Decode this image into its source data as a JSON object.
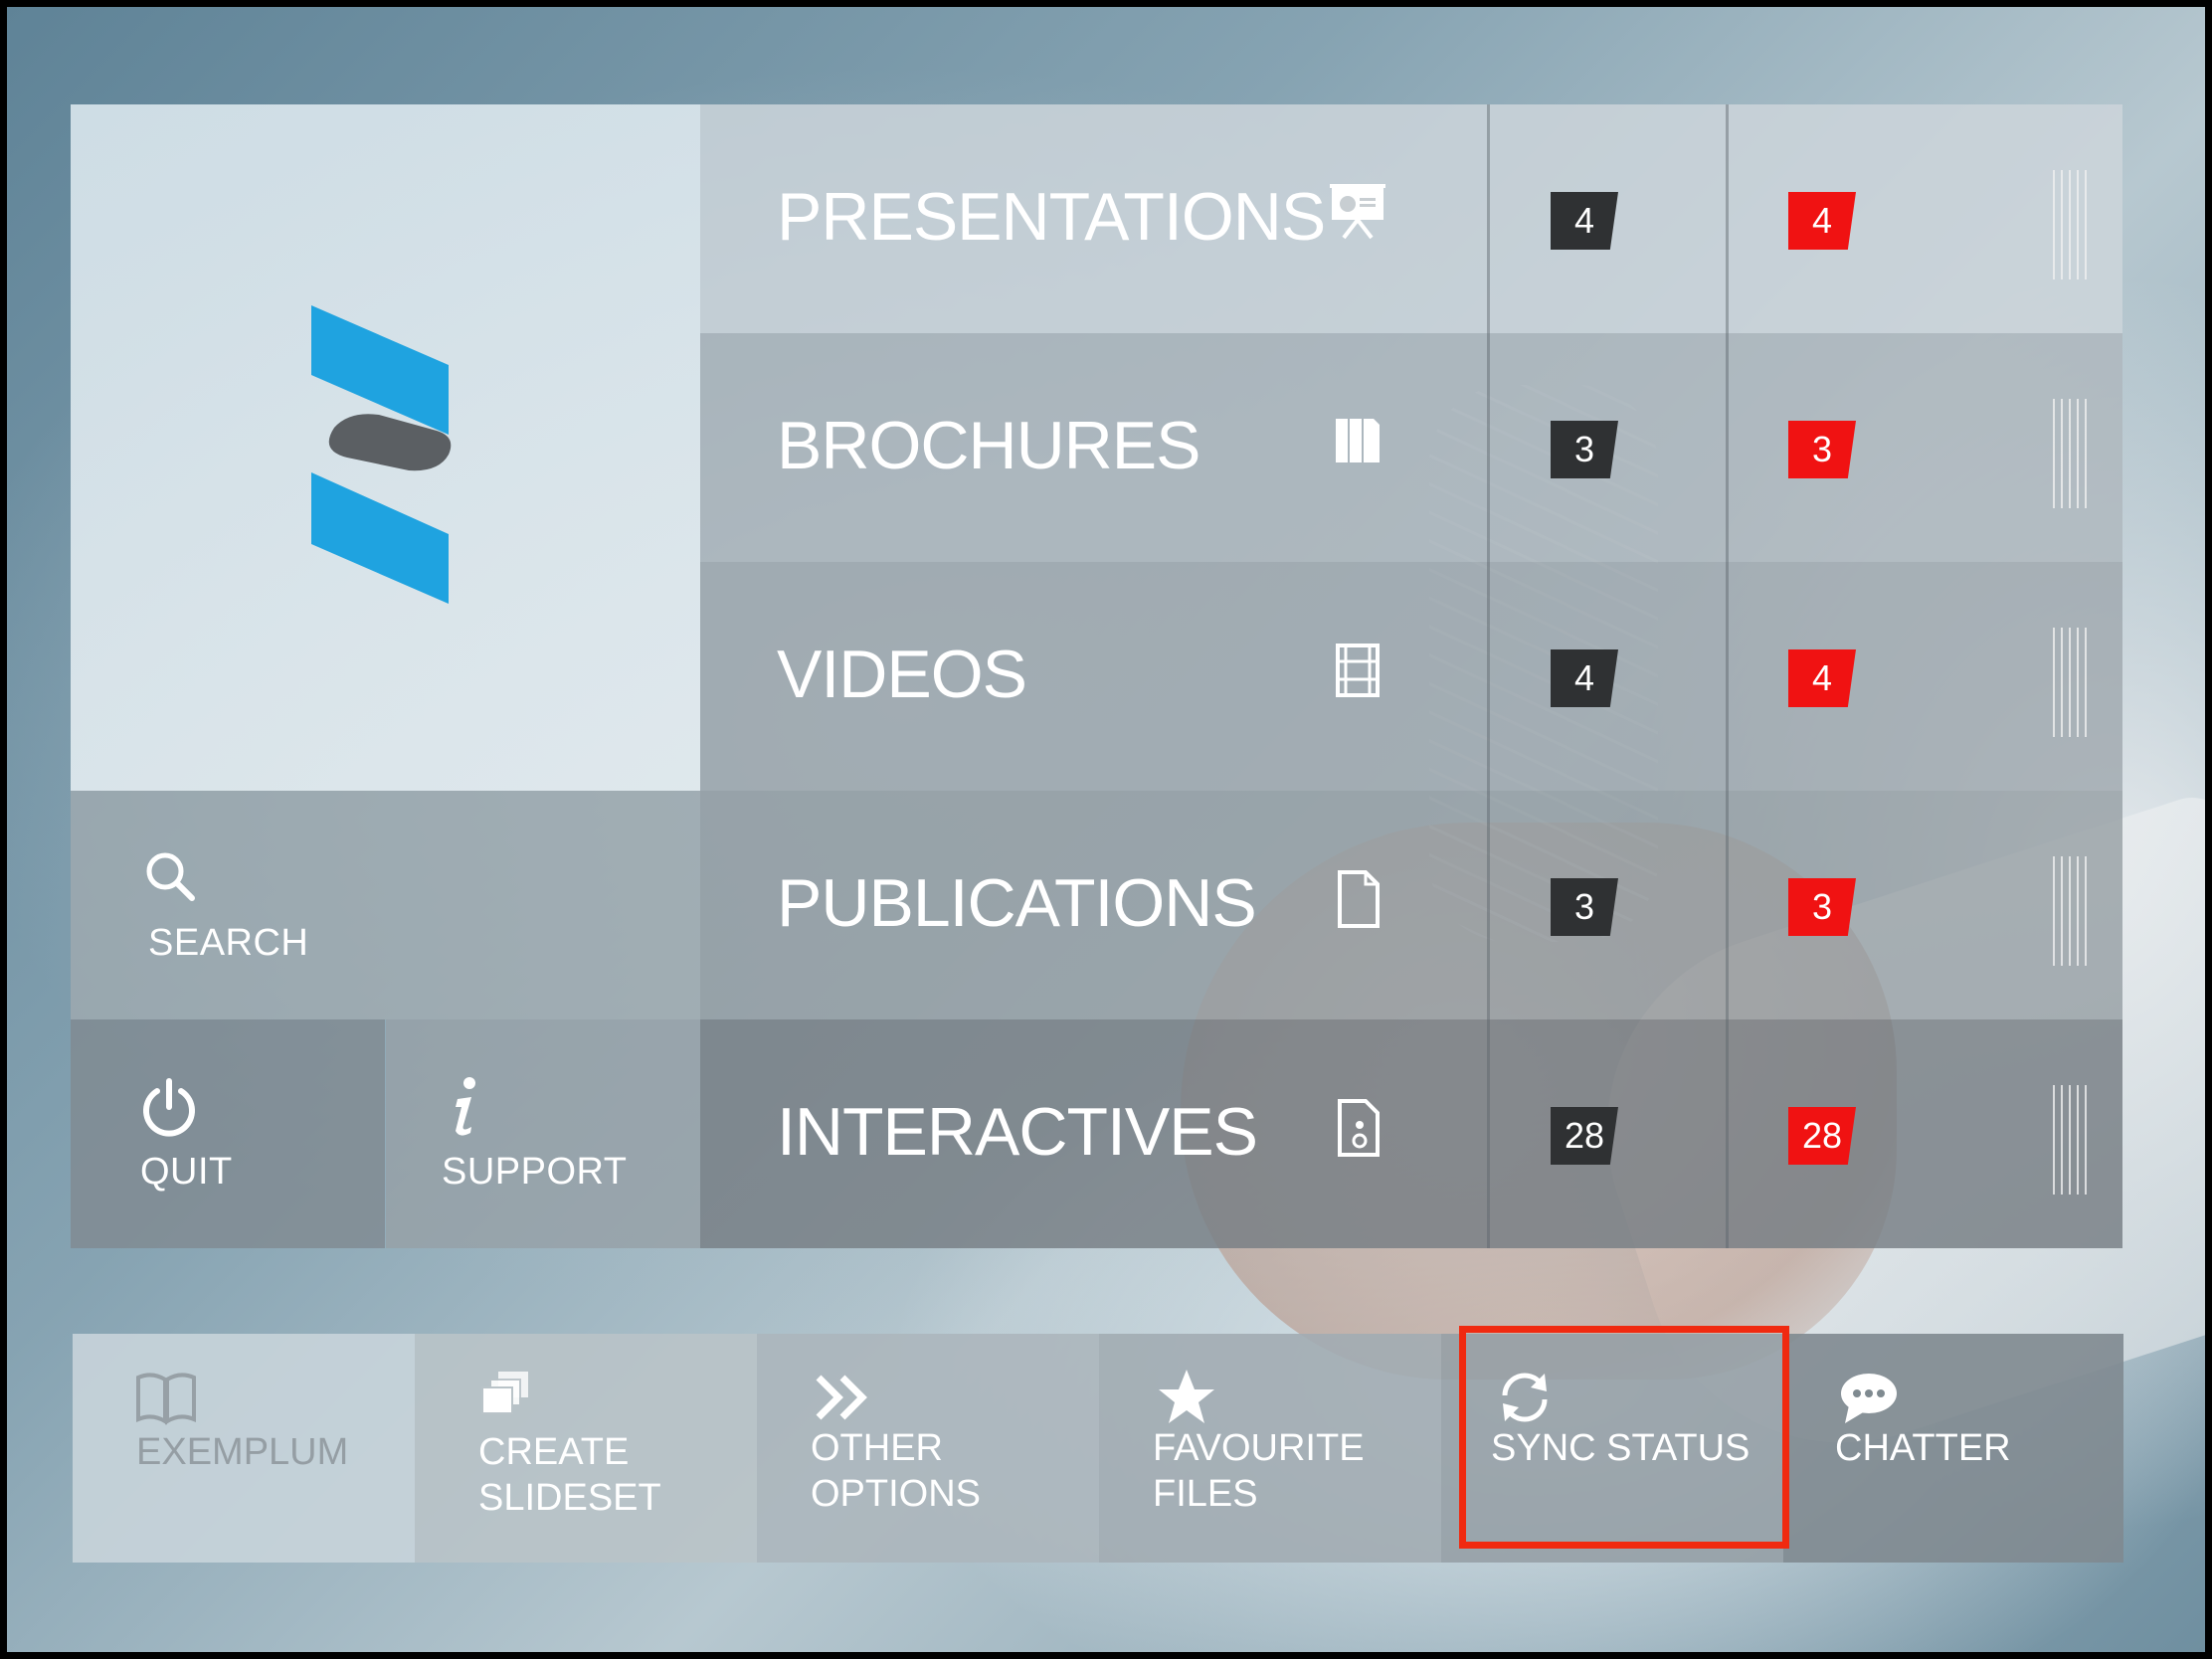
{
  "app": {
    "name": "Exemplum"
  },
  "colors": {
    "accent_red": "#f01212",
    "badge_dark": "#2f3133",
    "logo_blue": "#1fa3e0",
    "logo_grey": "#5b5f63",
    "highlight": "#f02a10"
  },
  "side_tiles": {
    "search": {
      "label": "SEARCH",
      "icon": "search-icon"
    },
    "quit": {
      "label": "QUIT",
      "icon": "power-icon"
    },
    "support": {
      "label": "SUPPORT",
      "icon": "info-icon"
    }
  },
  "categories": [
    {
      "label": "PRESENTATIONS",
      "icon": "presentation-icon",
      "count": "4",
      "new_count": "4"
    },
    {
      "label": "BROCHURES",
      "icon": "brochure-icon",
      "count": "3",
      "new_count": "3"
    },
    {
      "label": "VIDEOS",
      "icon": "film-icon",
      "count": "4",
      "new_count": "4"
    },
    {
      "label": "PUBLICATIONS",
      "icon": "document-icon",
      "count": "3",
      "new_count": "3"
    },
    {
      "label": "INTERACTIVES",
      "icon": "interactive-file-icon",
      "count": "28",
      "new_count": "28"
    }
  ],
  "bottom_bar": [
    {
      "line1": "EXEMPLUM",
      "line2": "",
      "icon": "book-icon"
    },
    {
      "line1": "CREATE",
      "line2": "SLIDESET",
      "icon": "slides-stack-icon"
    },
    {
      "line1": "OTHER",
      "line2": "OPTIONS",
      "icon": "double-chevron-right-icon"
    },
    {
      "line1": "FAVOURITE",
      "line2": "FILES",
      "icon": "star-icon"
    },
    {
      "line1": "SYNC STATUS",
      "line2": "",
      "icon": "sync-icon"
    },
    {
      "line1": "CHATTER",
      "line2": "",
      "icon": "chat-bubble-icon"
    }
  ]
}
